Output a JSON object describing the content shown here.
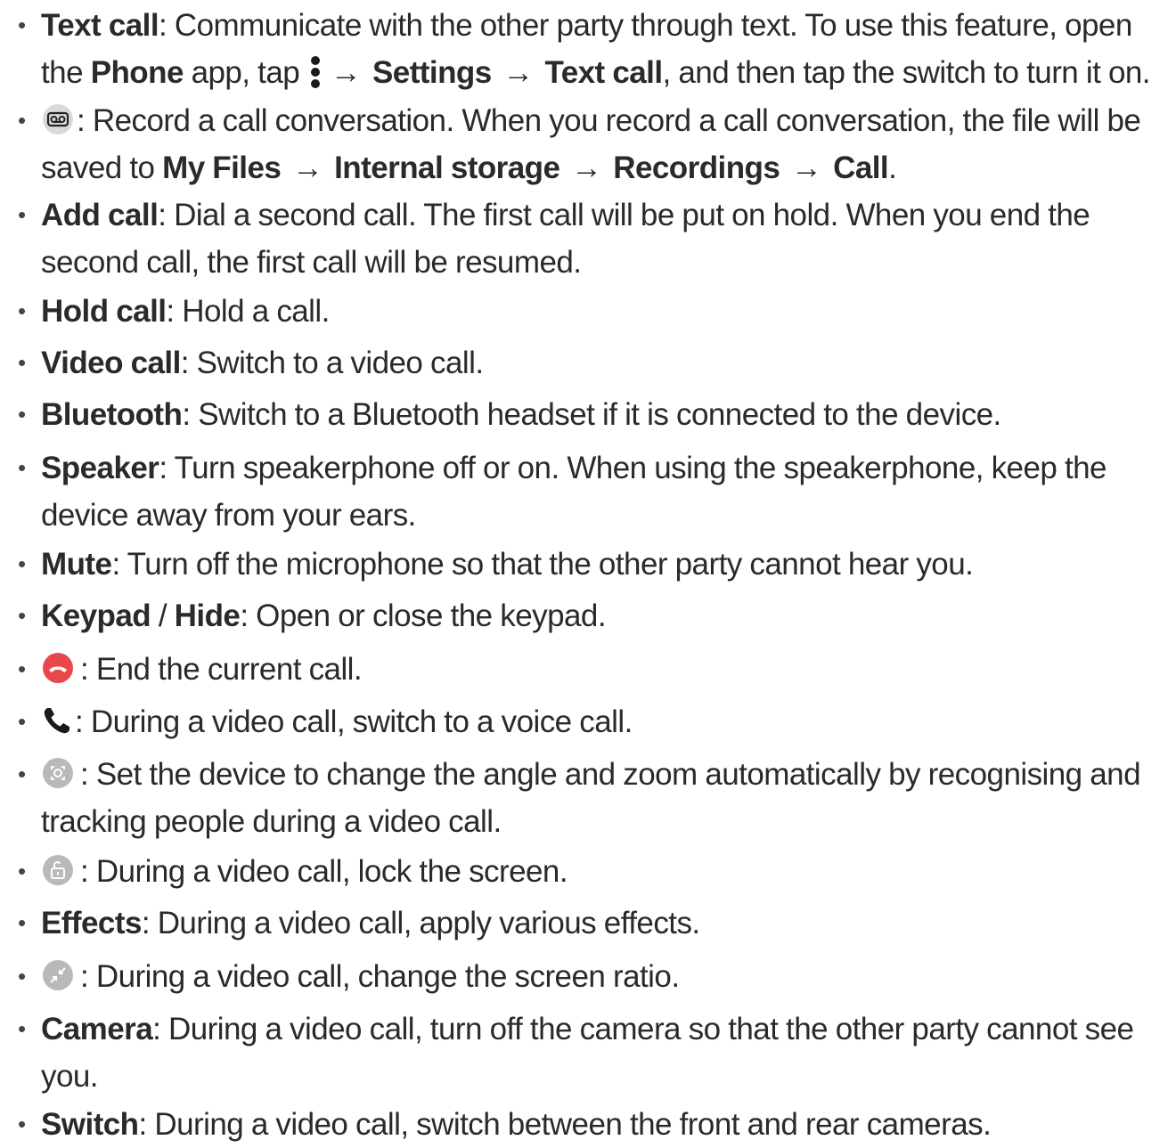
{
  "items": {
    "text_call": {
      "label": "Text call",
      "l1": ": Communicate with the other party through text. To use this feature, open",
      "l2a": "the ",
      "phone": "Phone",
      "l2b": " app, tap ",
      "settings": "Settings",
      "text_call_2": "Text call",
      "l2c": ", and then tap the switch to turn it on."
    },
    "record": {
      "icon": "voicemail-record-icon",
      "l1": ": Record a call conversation. When you record a call conversation, the file will be",
      "l2a": "saved to ",
      "my_files": "My Files",
      "internal": "Internal storage",
      "recordings": "Recordings",
      "call": "Call",
      "l2b": "."
    },
    "add_call": {
      "label": "Add call",
      "l1": ": Dial a second call. The first call will be put on hold. When you end the",
      "l2": "second call, the first call will be resumed."
    },
    "hold_call": {
      "label": "Hold call",
      "text": ": Hold a call."
    },
    "video_call": {
      "label": "Video call",
      "text": ": Switch to a video call."
    },
    "bluetooth": {
      "label": "Bluetooth",
      "text": ": Switch to a Bluetooth headset if it is connected to the device."
    },
    "speaker": {
      "label": "Speaker",
      "l1": ": Turn speakerphone off or on. When using the speakerphone, keep the",
      "l2": "device away from your ears."
    },
    "mute": {
      "label": "Mute",
      "text": ": Turn off the microphone so that the other party cannot hear you."
    },
    "keypad": {
      "label": "Keypad",
      "sep": " / ",
      "label2": "Hide",
      "text": ": Open or close the keypad."
    },
    "end_call": {
      "icon": "end-call-icon",
      "text": ": End the current call."
    },
    "voice": {
      "icon": "phone-icon",
      "text": ": During a video call, switch to a voice call."
    },
    "tracking": {
      "icon": "auto-framing-icon",
      "l1": ": Set the device to change the angle and zoom automatically by recognising and",
      "l2": "tracking people during a video call."
    },
    "lock": {
      "icon": "lock-icon",
      "text": ": During a video call, lock the screen."
    },
    "effects": {
      "label": "Effects",
      "text": ": During a video call, apply various effects."
    },
    "ratio": {
      "icon": "screen-ratio-icon",
      "text": ": During a video call, change the screen ratio."
    },
    "camera": {
      "label": "Camera",
      "l1": ": During a video call, turn off the camera so that the other party cannot see",
      "l2": "you."
    },
    "switch": {
      "label": "Switch",
      "text": ": During a video call, switch between the front and rear cameras."
    }
  },
  "bullet_char": "•",
  "arrow_char": "→",
  "colors": {
    "text": "#2a2a2a",
    "end_call_red": "#e8474b",
    "icon_gray": "#b8b8b8"
  }
}
